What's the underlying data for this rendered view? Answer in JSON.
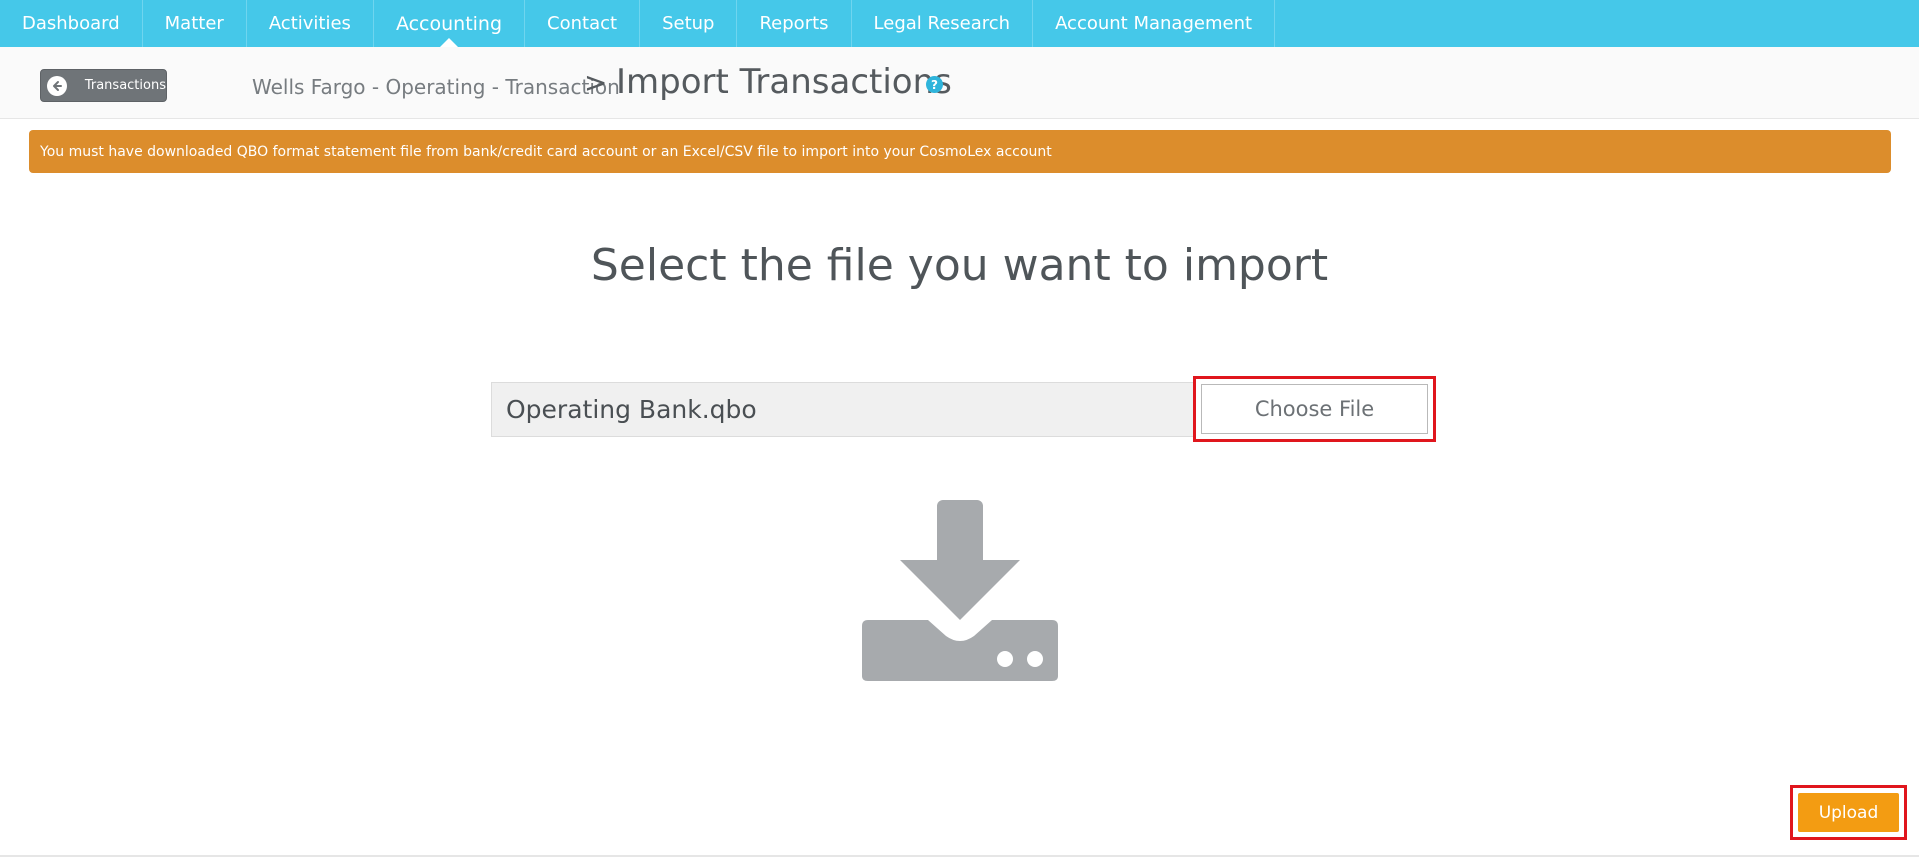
{
  "nav": {
    "items": [
      {
        "label": "Dashboard"
      },
      {
        "label": "Matter"
      },
      {
        "label": "Activities"
      },
      {
        "label": "Accounting"
      },
      {
        "label": "Contact"
      },
      {
        "label": "Setup"
      },
      {
        "label": "Reports"
      },
      {
        "label": "Legal Research"
      },
      {
        "label": "Account Management"
      }
    ],
    "active": "Accounting"
  },
  "header": {
    "back_label": "Transactions",
    "breadcrumb": "Wells Fargo - Operating - Transaction",
    "separator": ">",
    "title": "Import Transactions",
    "help_icon": "?"
  },
  "alert": {
    "text": "You must have downloaded QBO format statement file from bank/credit card account or an Excel/CSV file to import into your CosmoLex account"
  },
  "main": {
    "heading": "Select the file you want to import",
    "file_name": "Operating Bank.qbo",
    "choose_label": "Choose File",
    "upload_label": "Upload"
  },
  "colors": {
    "nav_bg": "#45c8e9",
    "alert_bg": "#dc8d2c",
    "upload_bg": "#f39c12",
    "highlight": "#e0161d",
    "graphic": "#a7aaad"
  }
}
